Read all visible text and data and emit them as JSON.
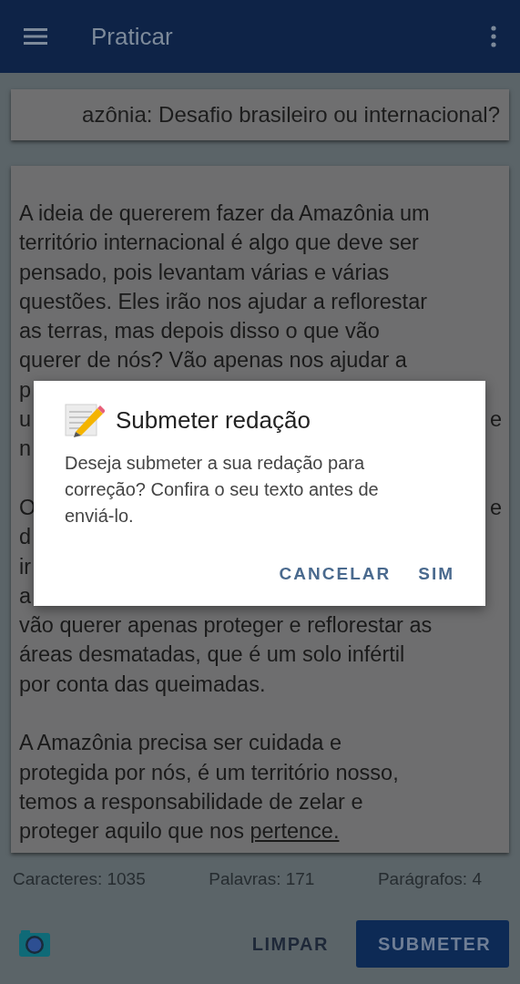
{
  "app_bar": {
    "title": "Praticar"
  },
  "essay_title": "azônia: Desafio brasileiro ou internacional?",
  "essay": [
    {
      "lines": [
        {
          "left": "A ideia de quererem fazer da Amazônia um"
        },
        {
          "left": "território internacional é algo que deve ser"
        },
        {
          "left": "pensado, pois levantam várias e várias"
        },
        {
          "left": "questões. Eles irão nos ajudar a reflorestar"
        },
        {
          "left": "as terras, mas depois disso o que vão"
        },
        {
          "left": "querer de nós? Vão apenas nos ajudar a"
        },
        {
          "left": "p"
        },
        {
          "left": "u",
          "right": "e"
        },
        {
          "left": "n"
        }
      ]
    },
    {
      "lines": [
        {
          "left": "O",
          "right": "e"
        },
        {
          "left": "d"
        },
        {
          "left": "ir"
        },
        {
          "left": "a"
        },
        {
          "left": "vão querer apenas proteger e reflorestar as"
        },
        {
          "left": "áreas desmatadas, que é um solo infértil"
        },
        {
          "left": "por conta das queimadas."
        }
      ]
    },
    {
      "lines": [
        {
          "left": "A Amazônia precisa ser cuidada e"
        },
        {
          "left": "protegida por nós, é um território nosso,"
        },
        {
          "left": "temos a responsabilidade de zelar e"
        },
        {
          "left": "proteger aquilo que nos",
          "flagged": "pertence."
        }
      ]
    }
  ],
  "stats": [
    "Caracteres: 1035",
    "Palavras: 171",
    "Parágrafos: 4"
  ],
  "actions": {
    "clear": "LIMPAR",
    "submit": "SUBMETER"
  },
  "dialog": {
    "title": "Submeter redação",
    "message": "Deseja submeter a sua redação para correção? Confira o seu texto antes de enviá-lo.",
    "buttons": [
      "CANCELAR",
      "SIM"
    ]
  }
}
